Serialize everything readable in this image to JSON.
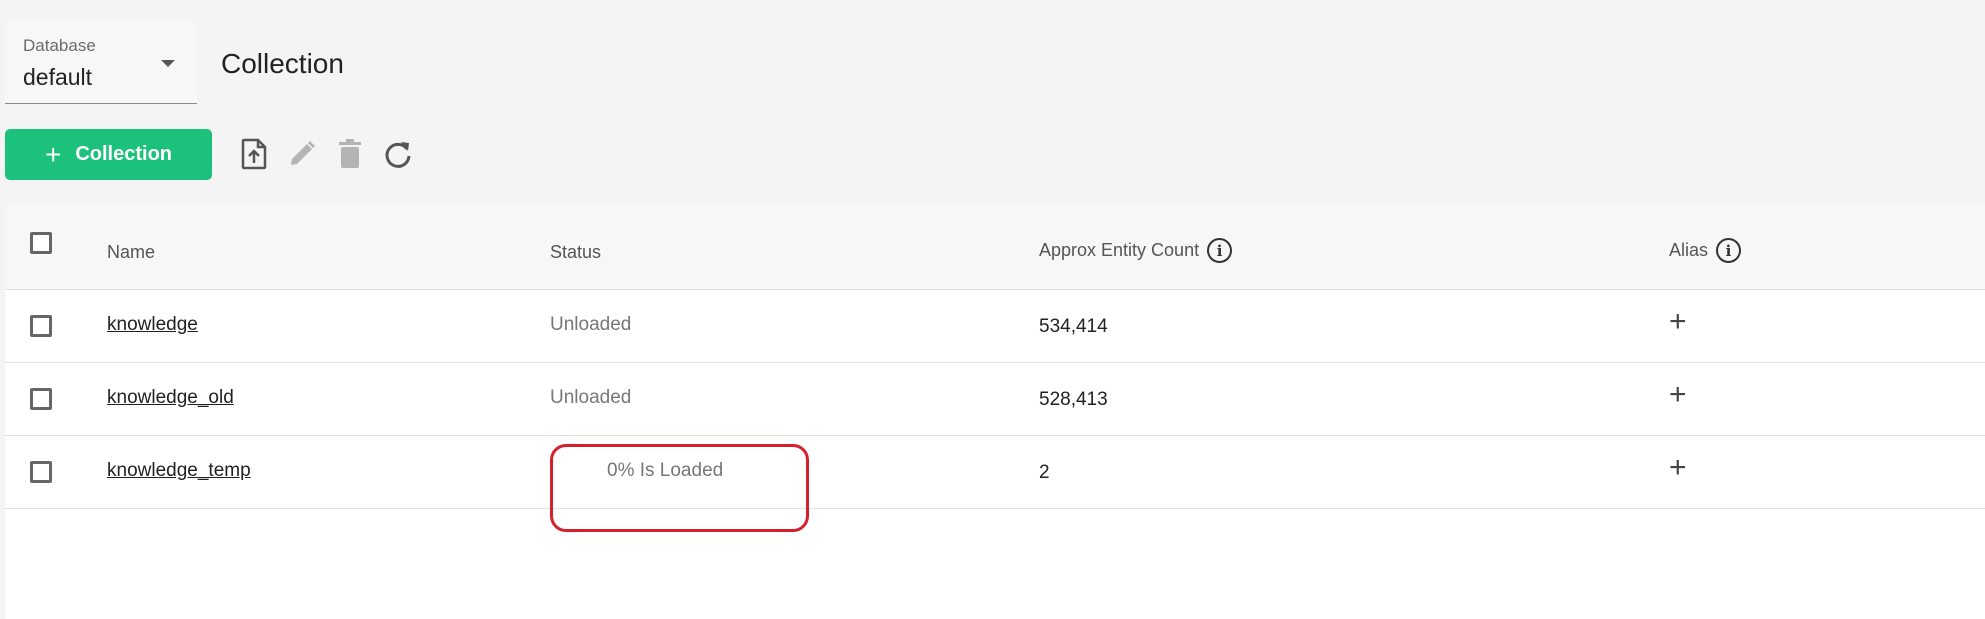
{
  "database": {
    "label": "Database",
    "value": "default"
  },
  "page": {
    "title": "Collection"
  },
  "toolbar": {
    "add_label": "Collection",
    "add_icon": "plus",
    "icons": [
      "file-upload-icon",
      "edit-pencil-icon",
      "trash-icon",
      "refresh-icon"
    ]
  },
  "table": {
    "columns": {
      "name": "Name",
      "status": "Status",
      "count": "Approx Entity Count",
      "alias": "Alias"
    },
    "rows": [
      {
        "name": "knowledge",
        "status": "Unloaded",
        "count": "534,414",
        "alias": "+"
      },
      {
        "name": "knowledge_old",
        "status": "Unloaded",
        "count": "528,413",
        "alias": "+"
      },
      {
        "name": "knowledge_temp",
        "status": "0% Is Loaded",
        "count": "2",
        "alias": "+"
      }
    ]
  },
  "colors": {
    "accent": "#1cc27b",
    "highlight": "#d8202a"
  }
}
